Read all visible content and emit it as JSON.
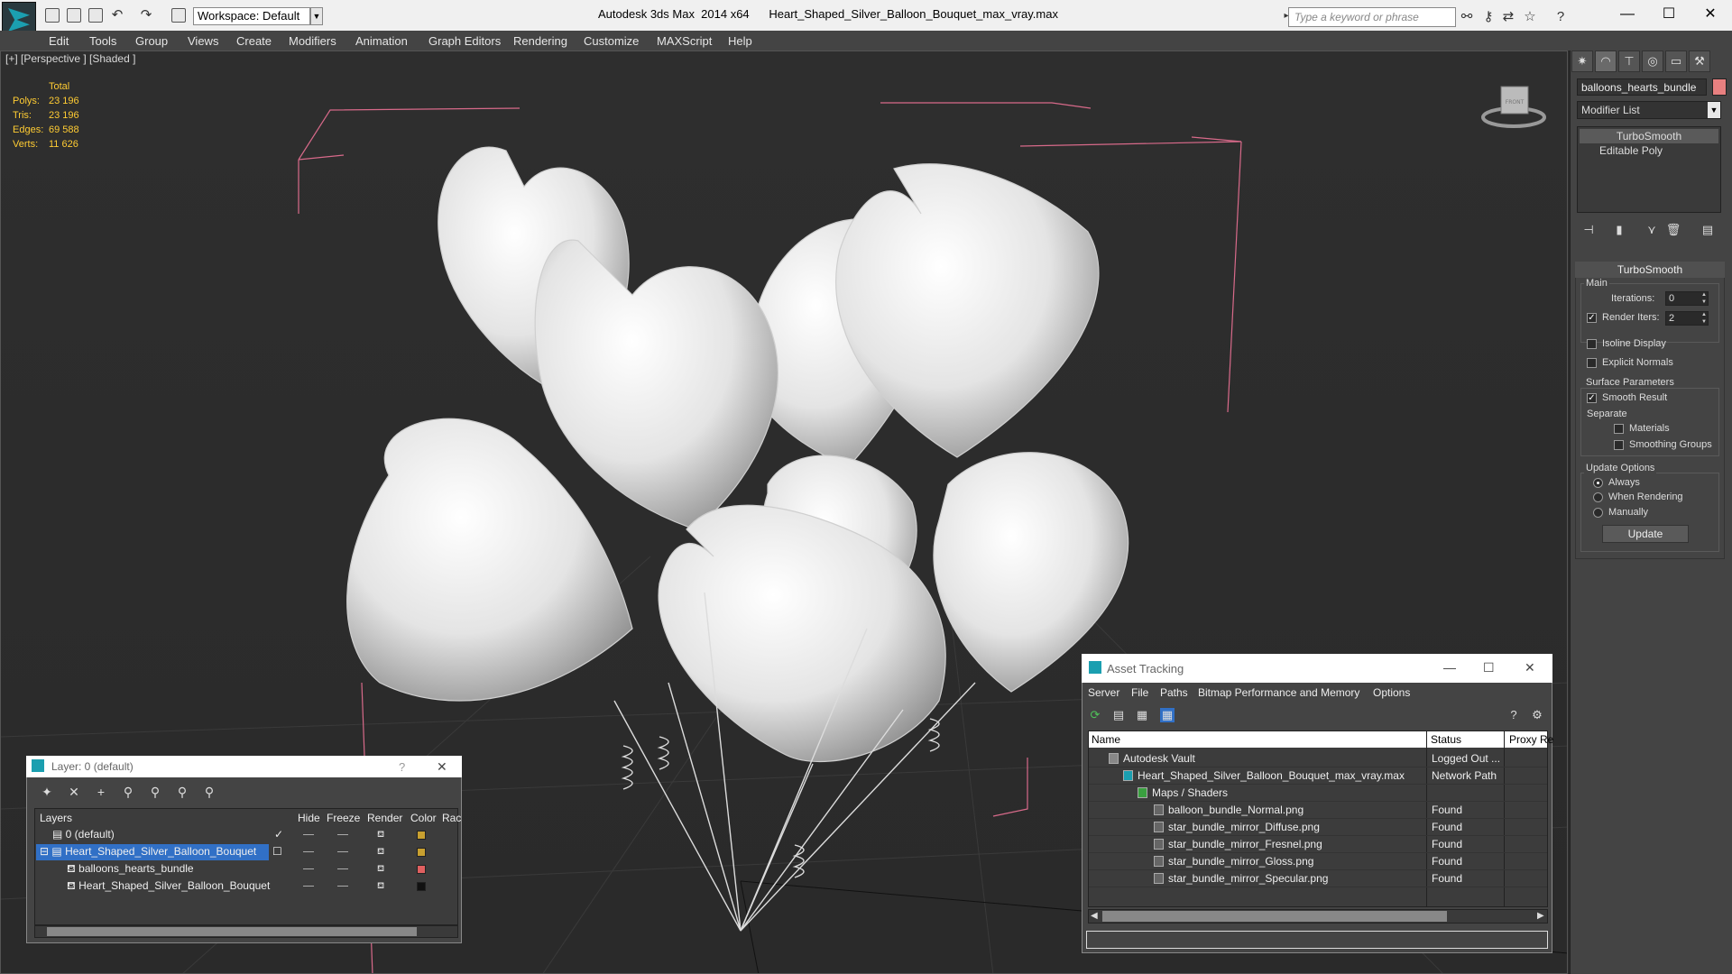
{
  "titlebar": {
    "workspace": "Workspace: Default",
    "app_name": "Autodesk 3ds Max  2014 x64",
    "file_name": "Heart_Shaped_Silver_Balloon_Bouquet_max_vray.max",
    "search_placeholder": "Type a keyword or phrase"
  },
  "menu": [
    "Edit",
    "Tools",
    "Group",
    "Views",
    "Create",
    "Modifiers",
    "Animation",
    "Graph Editors",
    "Rendering",
    "Customize",
    "MAXScript",
    "Help"
  ],
  "viewport": {
    "label": "[+] [Perspective ] [Shaded ]",
    "stats": {
      "header": "Total",
      "rows": [
        {
          "label": "Polys:",
          "value": "23 196"
        },
        {
          "label": "Tris:",
          "value": "23 196"
        },
        {
          "label": "Edges:",
          "value": "69 588"
        },
        {
          "label": "Verts:",
          "value": "11 626"
        }
      ]
    },
    "viewcube_label": "FRONT"
  },
  "command_panel": {
    "object_name": "balloons_hearts_bundle",
    "object_color": "#e88080",
    "modifier_list": "Modifier List",
    "stack": [
      "TurboSmooth",
      "Editable Poly"
    ],
    "rollout_title": "TurboSmooth",
    "main_group": "Main",
    "iterations_label": "Iterations:",
    "iterations_value": "0",
    "render_iters_label": "Render Iters:",
    "render_iters_value": "2",
    "isoline": "Isoline Display",
    "explicit_normals": "Explicit Normals",
    "surface_group": "Surface Parameters",
    "smooth_result": "Smooth Result",
    "separate": "Separate",
    "materials": "Materials",
    "smoothing_groups": "Smoothing Groups",
    "update_group": "Update Options",
    "always": "Always",
    "when_rendering": "When Rendering",
    "manually": "Manually",
    "update_button": "Update"
  },
  "layer_dialog": {
    "title": "Layer: 0 (default)",
    "help": "?",
    "columns": [
      "Layers",
      "Hide",
      "Freeze",
      "Render",
      "Color",
      "Rac"
    ],
    "rows": [
      {
        "name": "0 (default)",
        "color": "#c8a030"
      },
      {
        "name": "Heart_Shaped_Silver_Balloon_Bouquet",
        "color": "#c8a030"
      },
      {
        "name": "balloons_hearts_bundle",
        "color": "#e06060"
      },
      {
        "name": "Heart_Shaped_Silver_Balloon_Bouquet",
        "color": "#111111"
      }
    ]
  },
  "asset_dialog": {
    "title": "Asset Tracking",
    "menu": [
      "Server",
      "File",
      "Paths",
      "Bitmap Performance and Memory",
      "Options"
    ],
    "columns": [
      "Name",
      "Status",
      "Proxy Re"
    ],
    "rows": [
      {
        "name": "Autodesk Vault",
        "status": "Logged Out ..."
      },
      {
        "name": "Heart_Shaped_Silver_Balloon_Bouquet_max_vray.max",
        "status": "Network Path"
      },
      {
        "name": "Maps / Shaders",
        "status": ""
      },
      {
        "name": "balloon_bundle_Normal.png",
        "status": "Found"
      },
      {
        "name": "star_bundle_mirror_Diffuse.png",
        "status": "Found"
      },
      {
        "name": "star_bundle_mirror_Fresnel.png",
        "status": "Found"
      },
      {
        "name": "star_bundle_mirror_Gloss.png",
        "status": "Found"
      },
      {
        "name": "star_bundle_mirror_Specular.png",
        "status": "Found"
      }
    ]
  }
}
